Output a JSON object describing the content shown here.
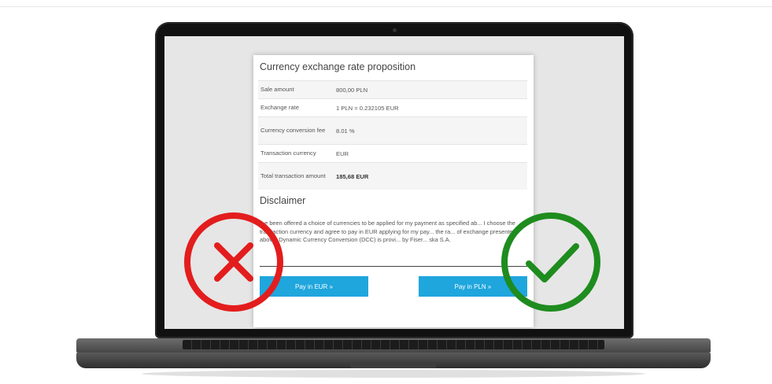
{
  "dialog": {
    "title": "Currency exchange rate proposition",
    "rows": [
      {
        "label": "Sale amount",
        "value": "800,00 PLN",
        "bold": false
      },
      {
        "label": "Exchange rate",
        "value": "1 PLN = 0.232105 EUR",
        "bold": false
      },
      {
        "label": "Currency conversion fee",
        "value": "8.01 %",
        "bold": false
      },
      {
        "label": "Transaction currency",
        "value": "EUR",
        "bold": false
      },
      {
        "label": "Total transaction amount",
        "value": "185,68 EUR",
        "bold": true
      }
    ],
    "disclaimer_title": "Disclaimer",
    "disclaimer_text": "...e been offered a choice of currencies to be applied for my payment as specified ab... I choose the transaction currency and agree to pay in EUR applying for my pay... the ra... of exchange presented above. Dynamic Currency Conversion (DCC) is provi... by Fiser... ska S.A.",
    "pay_eur_label": "Pay in EUR »",
    "pay_pln_label": "Pay in PLN »"
  },
  "marks": {
    "reject_icon": "x-circle-icon",
    "reject_color": "#e31d1d",
    "accept_icon": "check-circle-icon",
    "accept_color": "#1e8c1e"
  },
  "colors": {
    "button": "#1fa6dd",
    "screen_bg": "#e6e6e6"
  }
}
